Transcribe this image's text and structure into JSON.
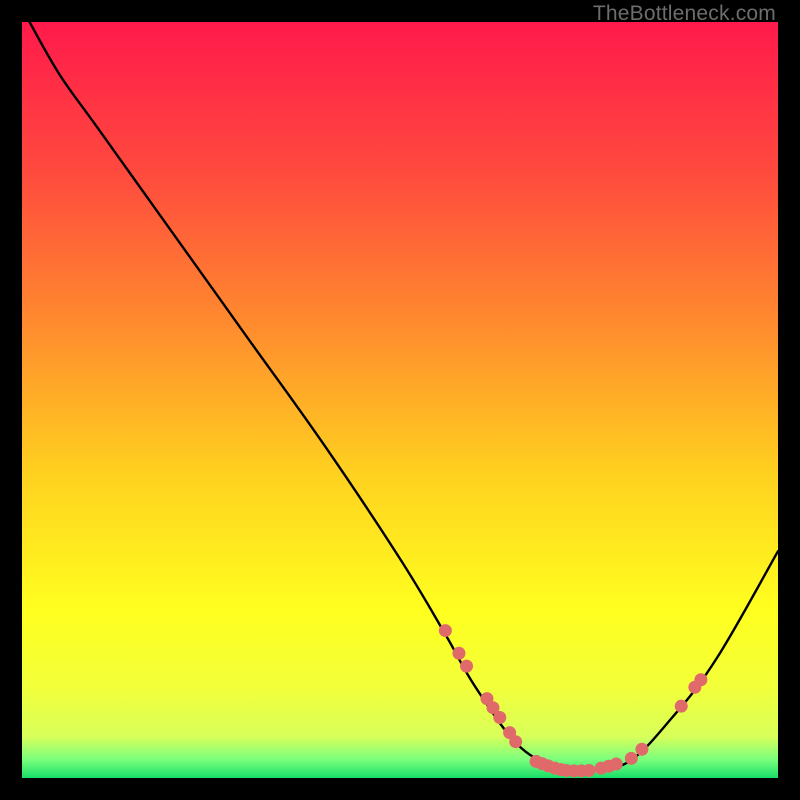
{
  "watermark": "TheBottleneck.com",
  "chart_data": {
    "type": "line",
    "title": "",
    "xlabel": "",
    "ylabel": "",
    "xlim": [
      0,
      100
    ],
    "ylim": [
      0,
      100
    ],
    "background_gradient": {
      "stops": [
        {
          "offset": 0.0,
          "color": "#ff1a4b"
        },
        {
          "offset": 0.2,
          "color": "#ff4a3e"
        },
        {
          "offset": 0.4,
          "color": "#ff8b2e"
        },
        {
          "offset": 0.6,
          "color": "#ffd21f"
        },
        {
          "offset": 0.78,
          "color": "#ffff1f"
        },
        {
          "offset": 0.88,
          "color": "#f2ff3a"
        },
        {
          "offset": 0.945,
          "color": "#d8ff5a"
        },
        {
          "offset": 0.975,
          "color": "#7dff7d"
        },
        {
          "offset": 1.0,
          "color": "#18e06a"
        }
      ]
    },
    "curve": {
      "x": [
        1,
        5,
        10,
        20,
        30,
        40,
        50,
        56,
        60,
        66,
        72,
        74,
        80,
        86,
        92,
        100
      ],
      "y": [
        100,
        93,
        86,
        72,
        58,
        44,
        29,
        19,
        12,
        4,
        1,
        1,
        2,
        8,
        16,
        30
      ]
    },
    "curve_stroke": "#000000",
    "curve_width": 2.4,
    "markers": {
      "color": "#e06a6a",
      "radius": 6.5,
      "points": [
        {
          "x": 56.0,
          "y": 19.5
        },
        {
          "x": 57.8,
          "y": 16.5
        },
        {
          "x": 58.8,
          "y": 14.8
        },
        {
          "x": 61.5,
          "y": 10.5
        },
        {
          "x": 62.3,
          "y": 9.3
        },
        {
          "x": 63.2,
          "y": 8.0
        },
        {
          "x": 64.5,
          "y": 6.0
        },
        {
          "x": 65.3,
          "y": 4.8
        },
        {
          "x": 68.0,
          "y": 2.2
        },
        {
          "x": 68.8,
          "y": 1.9
        },
        {
          "x": 69.6,
          "y": 1.6
        },
        {
          "x": 70.5,
          "y": 1.3
        },
        {
          "x": 71.3,
          "y": 1.1
        },
        {
          "x": 72.0,
          "y": 1.0
        },
        {
          "x": 73.0,
          "y": 0.95
        },
        {
          "x": 74.0,
          "y": 0.95
        },
        {
          "x": 75.0,
          "y": 1.0
        },
        {
          "x": 76.6,
          "y": 1.3
        },
        {
          "x": 77.6,
          "y": 1.55
        },
        {
          "x": 78.6,
          "y": 1.85
        },
        {
          "x": 80.6,
          "y": 2.6
        },
        {
          "x": 82.0,
          "y": 3.8
        },
        {
          "x": 87.2,
          "y": 9.5
        },
        {
          "x": 89.0,
          "y": 12.0
        },
        {
          "x": 89.8,
          "y": 13.0
        }
      ]
    }
  }
}
